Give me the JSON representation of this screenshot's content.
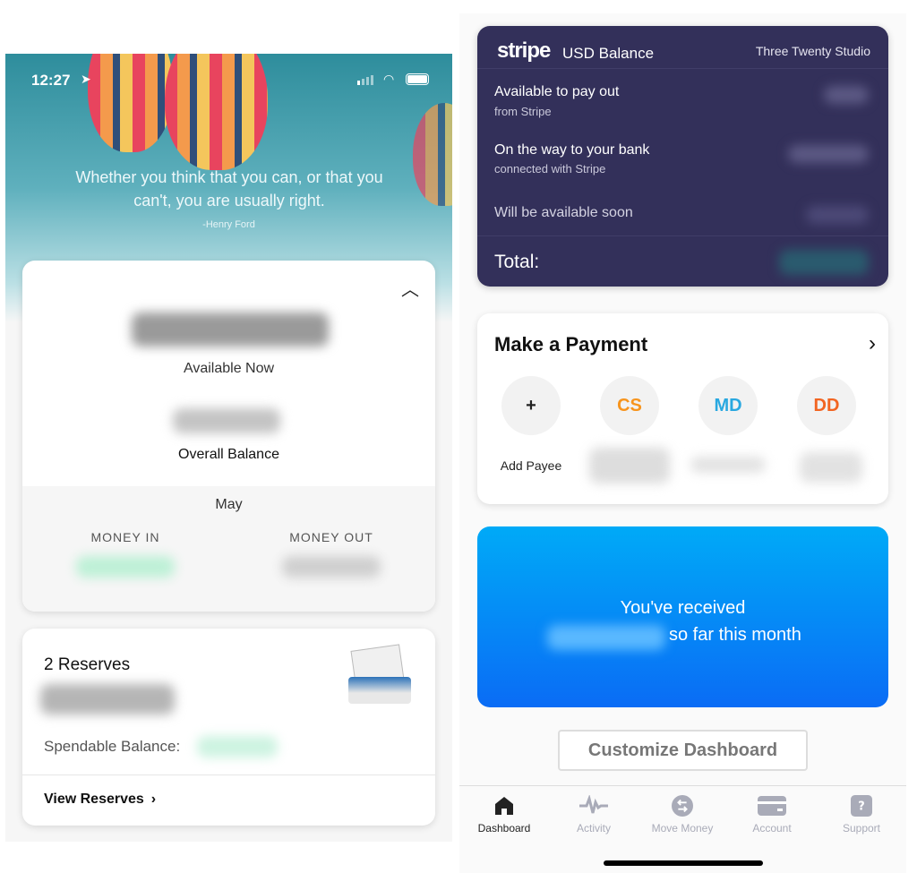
{
  "left": {
    "status": {
      "time": "12:27"
    },
    "quote": {
      "text": "Whether you think that you can, or that you can't, you are usually right.",
      "author": "-Henry Ford"
    },
    "balance_card": {
      "available_label": "Available Now",
      "overall_label": "Overall Balance",
      "month": "May",
      "money_in_label": "MONEY IN",
      "money_out_label": "MONEY OUT",
      "money_in_color": "#7ee0b4"
    },
    "reserves_card": {
      "title": "2 Reserves",
      "spendable_label": "Spendable Balance:",
      "view_label": "View Reserves",
      "chevron": "›"
    }
  },
  "right": {
    "stripe_card": {
      "logo": "stripe",
      "title": "USD Balance",
      "account": "Three Twenty Studio",
      "rows": [
        {
          "label": "Available to pay out",
          "sub": "from Stripe"
        },
        {
          "label": "On the way to your bank",
          "sub": "connected with Stripe"
        },
        {
          "label": "Will be available soon",
          "sub": ""
        }
      ],
      "total_label": "Total:",
      "bg": "#33305a"
    },
    "payment_card": {
      "title": "Make a Payment",
      "payees": [
        {
          "initials": "+",
          "label": "Add Payee",
          "color": "#222222"
        },
        {
          "initials": "CS",
          "color": "#f7941d"
        },
        {
          "initials": "MD",
          "color": "#29a8e0"
        },
        {
          "initials": "DD",
          "color": "#f26522"
        }
      ]
    },
    "received_card": {
      "line1": "You've received",
      "line2": "so far this month"
    },
    "customize_label": "Customize Dashboard",
    "tabs": [
      {
        "label": "Dashboard",
        "icon": "home-icon",
        "active": true
      },
      {
        "label": "Activity",
        "icon": "activity-icon"
      },
      {
        "label": "Move Money",
        "icon": "transfer-icon"
      },
      {
        "label": "Account",
        "icon": "card-icon"
      },
      {
        "label": "Support",
        "icon": "help-icon"
      }
    ]
  }
}
